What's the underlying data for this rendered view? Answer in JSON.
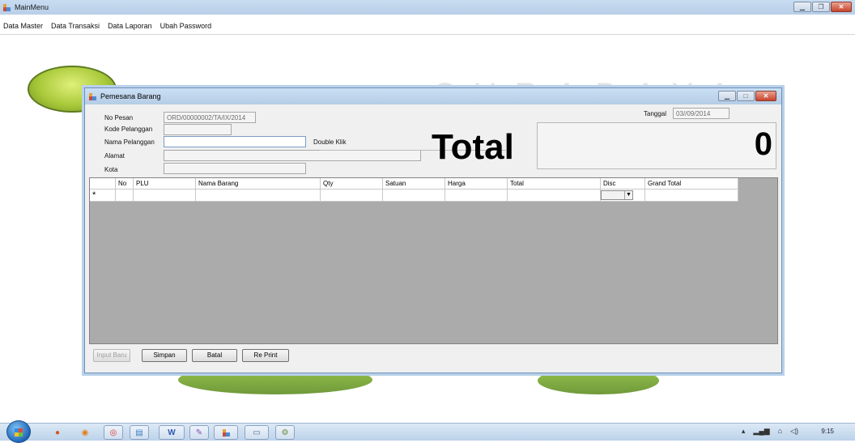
{
  "main_window": {
    "title": "MainMenu",
    "menu": [
      "Data Master",
      "Data Transaksi",
      "Data Laporan",
      "Ubah Password"
    ]
  },
  "watermark": "SURABAYA",
  "form": {
    "title": "Pemesana Barang",
    "labels": {
      "no_pesan": "No Pesan",
      "kode_pelanggan": "Kode Pelanggan",
      "nama_pelanggan": "Nama Pelanggan",
      "alamat": "Alamat",
      "kota": "Kota",
      "tanggal": "Tanggal",
      "double_klik": "Double Klik"
    },
    "values": {
      "no_pesan": "ORD/00000002/TA/IX/2014",
      "kode_pelanggan": "",
      "nama_pelanggan": "",
      "alamat": "",
      "kota": "",
      "tanggal": "03//09/2014"
    },
    "total_label": "Total",
    "total_value": "0",
    "grid": {
      "columns": [
        "No",
        "PLU",
        "Nama Barang",
        "Qty",
        "Satuan",
        "Harga",
        "Total",
        "Disc",
        "Grand Total"
      ],
      "new_row_marker": "*"
    },
    "buttons": {
      "input_baru": "Input Baru",
      "simpan": "Simpan",
      "batal": "Batal",
      "re_print": "Re Print"
    }
  },
  "taskbar": {
    "clock": "9:15"
  }
}
